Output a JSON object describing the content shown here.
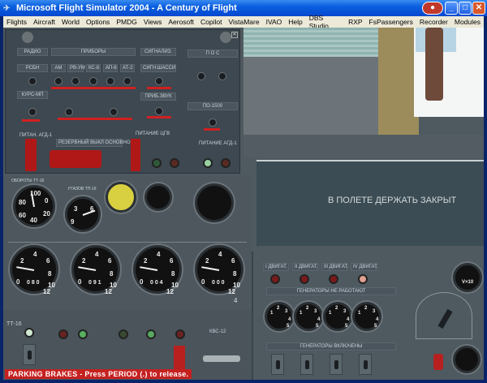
{
  "window": {
    "title": "Microsoft Flight Simulator 2004 - A Century of Flight"
  },
  "menu": [
    "Flights",
    "Aircraft",
    "World",
    "Options",
    "PMDG",
    "Views",
    "Aerosoft",
    "Copilot",
    "VistaMare",
    "IVAO",
    "Help",
    "DBS Studio",
    "RXP",
    "FsPassengers",
    "Recorder",
    "Modules"
  ],
  "overhead": {
    "radio": "РАДИО",
    "rsbn": "РСБН",
    "kurs": "КУРС-МП",
    "pribory": "ПРИБОРЫ",
    "instr": [
      "АМ",
      "РВ-УМ",
      "КС-8",
      "АП-6",
      "АТ-2"
    ],
    "signal": "СИГНАЛИЗ.",
    "signal_chassis": "СИГН.ШАССИ",
    "prib_zvuk": "ПРИБ.ЗВУК",
    "pos": "П О С",
    "po1500": "ПО-1500",
    "pitan_agd": "ПИТАН. АГД-1",
    "rezerv": "РЕЗЕРВНЫЙ ВЫКЛ ОСНОВНОЙ",
    "pitan_tsgv": "ПИТАНИЕ ЦГВ",
    "pitan_agd2": "ПИТАНИЕ АГД-1"
  },
  "placard": "В ПОЛЕТЕ ДЕРЖАТЬ ЗАКРЫТ",
  "gauges": {
    "rpm_label": "ОБОРОТЫ ТТ-16",
    "rpm_ticks": [
      "100",
      "80",
      "60",
      "40",
      "20",
      "0"
    ],
    "temp_label": "t°ГАЗОВ ТП-16",
    "temp_ticks": [
      "3",
      "6",
      "9"
    ],
    "engine_ticks": [
      "0",
      "2",
      "4",
      "6",
      "8",
      "10",
      "12"
    ],
    "engine_readouts": [
      "0 8 0",
      "0 9 1",
      "0 0 4",
      "0 0 0"
    ],
    "bottom_index": "4"
  },
  "electrical": {
    "engines": [
      "I ДВИГАТ.",
      "II ДВИГАТ.",
      "III ДВИГАТ.",
      "IV ДВИГАТ."
    ],
    "gen_off": "ГЕНЕРАТОРЫ НЕ РАБОТАЮТ",
    "gen_on": "ГЕНЕРАТОРЫ ВКЛЮЧЕНЫ",
    "voltage_label": "V×10",
    "amp_ticks": [
      "1",
      "2",
      "3",
      "4",
      "5"
    ]
  },
  "lower_left": {
    "tt16": "ТТ-16",
    "kvs": "КВС-12"
  },
  "status": {
    "parking": "PARKING BRAKES - Press PERIOD (.) to release."
  }
}
